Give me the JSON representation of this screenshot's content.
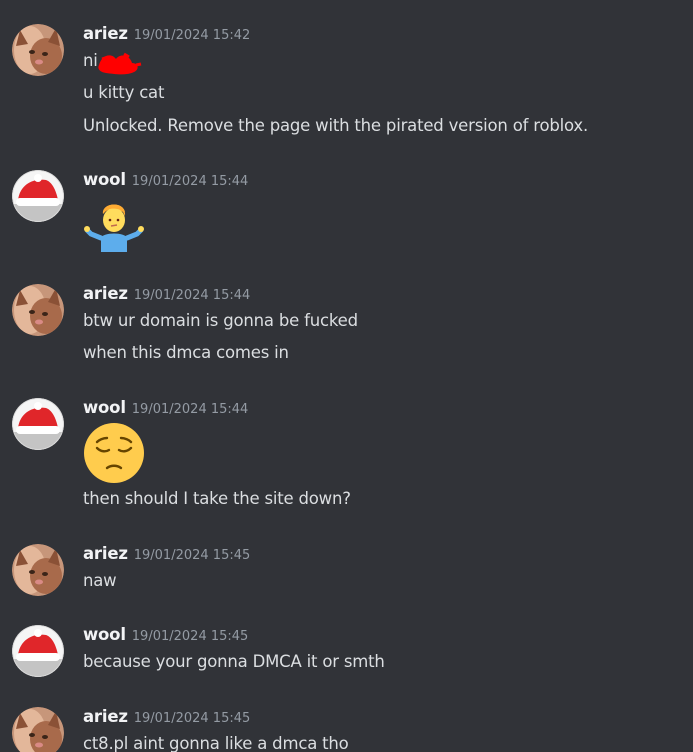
{
  "messages": [
    {
      "username": "ariez",
      "timestamp": "19/01/2024 15:42",
      "lines": [
        "ni",
        "u kitty cat",
        "Unlocked. Remove the page with the pirated version of roblox."
      ]
    },
    {
      "username": "wool",
      "timestamp": "19/01/2024 15:44",
      "emoji": "person-shrugging-emoji"
    },
    {
      "username": "ariez",
      "timestamp": "19/01/2024 15:44",
      "lines": [
        "btw ur domain is gonna be fucked",
        "when this dmca comes in"
      ]
    },
    {
      "username": "wool",
      "timestamp": "19/01/2024 15:44",
      "emoji": "pensive-face-emoji",
      "lines": [
        "then should I take the site down?"
      ]
    },
    {
      "username": "ariez",
      "timestamp": "19/01/2024 15:45",
      "lines": [
        "naw"
      ]
    },
    {
      "username": "wool",
      "timestamp": "19/01/2024 15:45",
      "lines": [
        "because your gonna DMCA it or smth"
      ]
    },
    {
      "username": "ariez",
      "timestamp": "19/01/2024 15:45",
      "lines": [
        "ct8.pl aint gonna like a dmca tho"
      ]
    }
  ],
  "colors": {
    "background": "#313338",
    "username": "#f2f3f5",
    "timestamp": "#949ba4",
    "message_text": "#dbdee1",
    "redaction": "#ff0000"
  }
}
